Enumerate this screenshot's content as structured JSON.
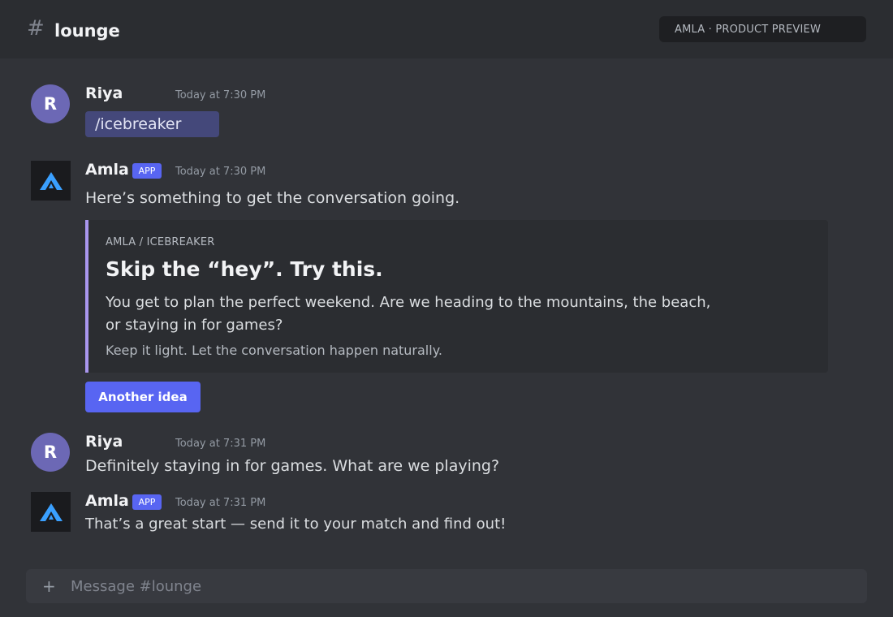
{
  "header": {
    "channel_symbol": "#",
    "channel_name": "lounge",
    "badge": "AMLA · PRODUCT PREVIEW"
  },
  "messages": [
    {
      "author": "Riya",
      "avatar_initial": "R",
      "timestamp": "Today at 7:30 PM",
      "command": "/icebreaker"
    },
    {
      "author": "Amla",
      "tag": "APP",
      "timestamp": "Today at 7:30 PM",
      "text": "Here’s something to get the conversation going.",
      "embed": {
        "provider": "AMLA / ICEBREAKER",
        "title": "Skip the “hey”. Try this.",
        "description": "You get to plan the perfect weekend. Are we heading to the mountains, the beach, or staying in for games?",
        "footer": "Keep it light. Let the conversation happen naturally."
      },
      "button_label": "Another idea"
    },
    {
      "author": "Riya",
      "avatar_initial": "R",
      "timestamp": "Today at 7:31 PM",
      "text": "Definitely staying in for games. What are we playing?"
    },
    {
      "author": "Amla",
      "tag": "APP",
      "timestamp": "Today at 7:31 PM",
      "text": "That’s a great start — send it to your match and find out!"
    }
  ],
  "composer": {
    "plus": "+",
    "placeholder": "Message #lounge"
  },
  "colors": {
    "background": "#313338",
    "accent": "#5865f2",
    "embed_bar": "#a996ee",
    "bot_logo": "#3aa0ff"
  }
}
